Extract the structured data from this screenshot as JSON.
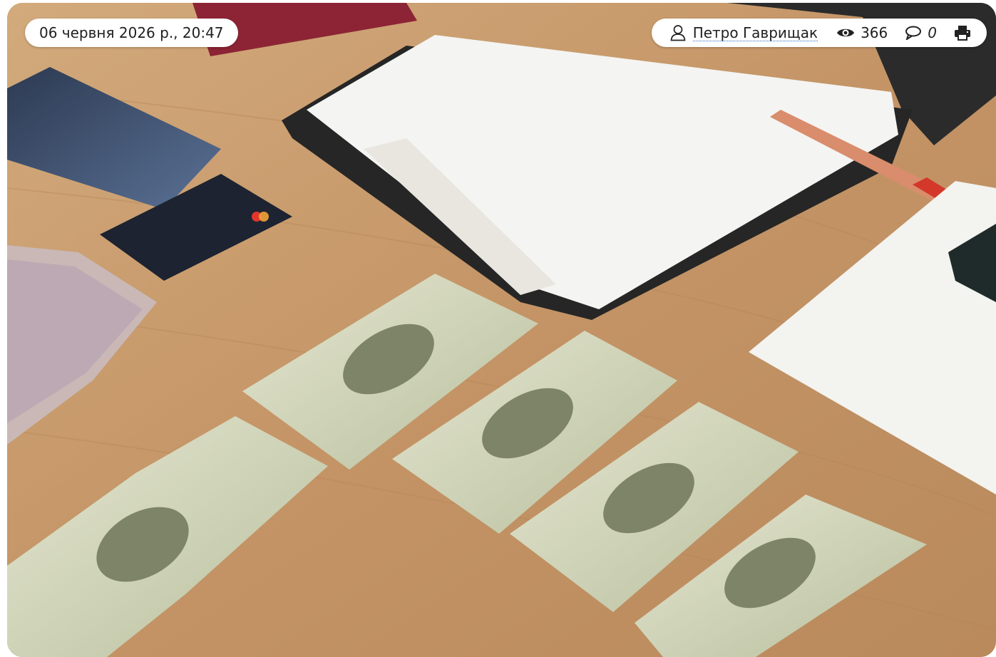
{
  "post": {
    "datetime": "06 червня 2026 р., 20:47",
    "author": "Петро Гаврищак",
    "views": "366",
    "comments": "0"
  },
  "icons": {
    "author": "user-icon",
    "views": "eye-icon",
    "comments": "comment-icon",
    "print": "printer-icon"
  }
}
